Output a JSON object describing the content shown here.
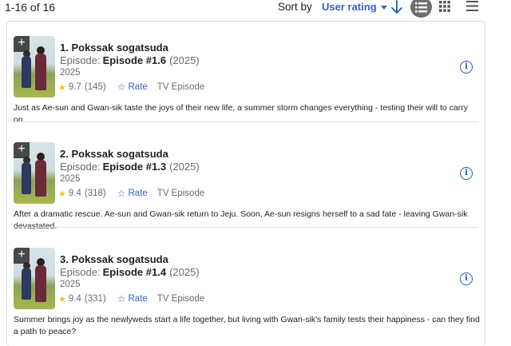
{
  "header": {
    "count": "1-16 of 16",
    "sort_label": "Sort by",
    "sort_value": "User rating",
    "icons": [
      "arrow-down-icon",
      "list-view-icon",
      "grid-view-icon",
      "compact-view-icon"
    ]
  },
  "colors": {
    "accent": "#3a62c8",
    "star": "#f5c518",
    "info": "#1a5fb4",
    "active_view_bg": "#6f6f6f"
  },
  "items": [
    {
      "title": "1. Pokssak sogatsuda",
      "episode_label": "Episode:",
      "episode": "Episode #1.6",
      "episode_year": "(2025)",
      "year": "2025",
      "rating": "9.7",
      "votes": "(145)",
      "rate_label": "Rate",
      "type": "TV Episode",
      "description": "Just as Ae-sun and Gwan-sik taste the joys of their new life, a summer storm changes everything - testing their will to carry on."
    },
    {
      "title": "2. Pokssak sogatsuda",
      "episode_label": "Episode:",
      "episode": "Episode #1.3",
      "episode_year": "(2025)",
      "year": "2025",
      "rating": "9.4",
      "votes": "(318)",
      "rate_label": "Rate",
      "type": "TV Episode",
      "description": "After a dramatic rescue. Ae-sun and Gwan-sik return to Jeju. Soon, Ae-sun resigns herself to a sad fate - leaving Gwan-sik devastated."
    },
    {
      "title": "3. Pokssak sogatsuda",
      "episode_label": "Episode:",
      "episode": "Episode #1.4",
      "episode_year": "(2025)",
      "year": "2025",
      "rating": "9.4",
      "votes": "(331)",
      "rate_label": "Rate",
      "type": "TV Episode",
      "description": "Summer brings joy as the newlyweds start a life together, but living with Gwan-sik's family tests their happiness - can they find a path to peace?"
    }
  ]
}
